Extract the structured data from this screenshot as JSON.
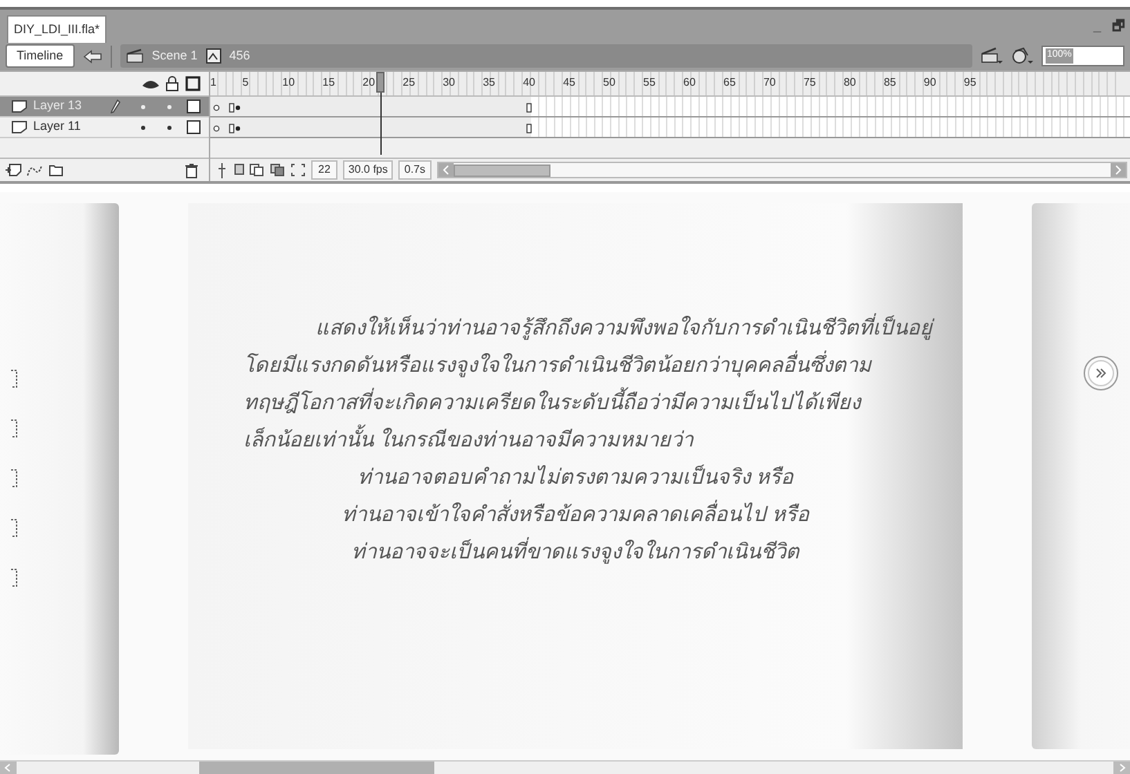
{
  "document_tab": {
    "title": "DIY_LDI_III.fla*"
  },
  "window_controls": [
    "_",
    "🗗"
  ],
  "edit_bar": {
    "timeline_button": "Timeline",
    "scene": "Scene 1",
    "symbol": "456",
    "zoom": "100%"
  },
  "timeline": {
    "ruler": [
      "1",
      "5",
      "10",
      "15",
      "20",
      "25",
      "30",
      "35",
      "40",
      "45",
      "50",
      "55",
      "60",
      "65",
      "70",
      "75",
      "80",
      "85",
      "90",
      "95"
    ],
    "layers": [
      {
        "name": "Layer 13",
        "selected": true,
        "editing": true
      },
      {
        "name": "Layer 11",
        "selected": false,
        "editing": false
      }
    ],
    "current_frame": "22",
    "frame_rate": "30.0 fps",
    "elapsed_time": "0.7s"
  },
  "stage": {
    "lines": [
      "แสดงให้เห็นว่าท่านอาจรู้สึกถึงความพึงพอใจกับการดำเนินชีวิตที่เป็นอยู่",
      "โดยมีแรงกดดันหรือแรงจูงใจในการดำเนินชีวิตน้อยกว่าบุคคลอื่นซึ่งตาม",
      "ทฤษฎีโอกาสที่จะเกิดความเครียดในระดับนี้ถือว่ามีความเป็นไปได้เพียง",
      "เล็กน้อยเท่านั้น ในกรณีของท่านอาจมีความหมายว่า",
      "ท่านอาจตอบคำถามไม่ตรงตามความเป็นจริง  หรือ",
      "ท่านอาจเข้าใจคำสั่งหรือข้อความคลาดเคลื่อนไป  หรือ",
      "ท่านอาจจะเป็นคนที่ขาดแรงจูงใจในการดำเนินชีวิต"
    ]
  }
}
